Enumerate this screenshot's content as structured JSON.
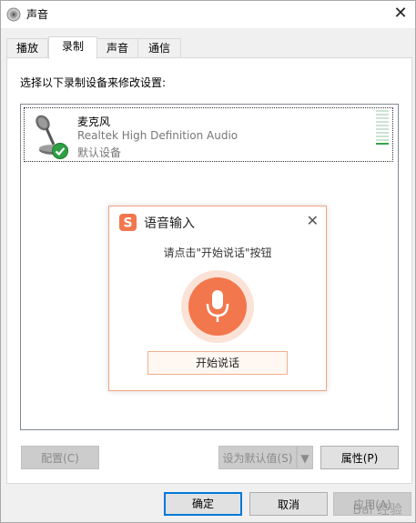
{
  "window": {
    "title": "声音",
    "close_glyph": "✕"
  },
  "tabs": [
    {
      "label": "播放",
      "active": false
    },
    {
      "label": "录制",
      "active": true
    },
    {
      "label": "声音",
      "active": false
    },
    {
      "label": "通信",
      "active": false
    }
  ],
  "panel": {
    "instruction": "选择以下录制设备来修改设置:",
    "devices": [
      {
        "name": "麦克风",
        "description": "Realtek High Definition Audio",
        "status": "默认设备",
        "icon": "microphone-icon",
        "default_badge": "check-icon",
        "level_active_fraction": 0.1
      }
    ],
    "buttons": {
      "configure": "配置(C)",
      "set_default": "设为默认值(S)",
      "properties": "属性(P)"
    }
  },
  "footer": {
    "ok": "确定",
    "cancel": "取消",
    "apply": "应用(A)"
  },
  "voice_popup": {
    "title": "语音输入",
    "close_glyph": "✕",
    "hint": "请点击\"开始说话\"按钮",
    "start_button": "开始说话",
    "accent_color": "#f2774d",
    "logo_letter": "S"
  },
  "watermark": "Bai 经验"
}
